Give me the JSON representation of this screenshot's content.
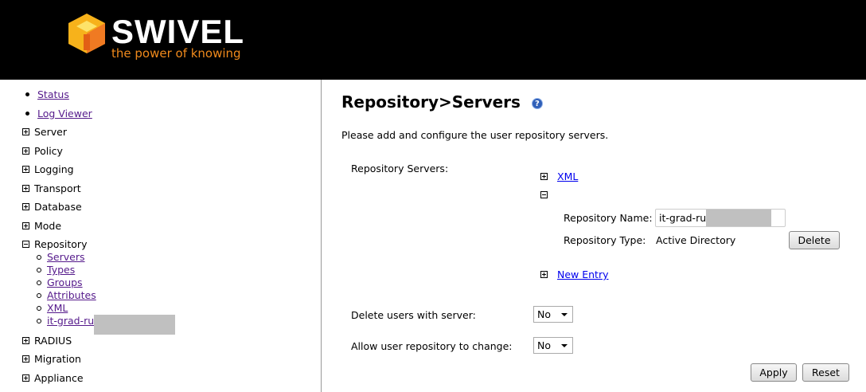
{
  "brand": {
    "name": "SWIVEL",
    "tagline": "the power of knowing",
    "accent": "#f08a1c"
  },
  "sidebar": {
    "links": [
      {
        "label": "Status"
      },
      {
        "label": "Log Viewer"
      }
    ],
    "sections": [
      {
        "label": "Server"
      },
      {
        "label": "Policy"
      },
      {
        "label": "Logging"
      },
      {
        "label": "Transport"
      },
      {
        "label": "Database"
      },
      {
        "label": "Mode"
      },
      {
        "label": "Repository"
      },
      {
        "label": "RADIUS"
      },
      {
        "label": "Migration"
      },
      {
        "label": "Appliance"
      }
    ],
    "repository_items": [
      {
        "label": "Servers"
      },
      {
        "label": "Types"
      },
      {
        "label": "Groups"
      },
      {
        "label": "Attributes"
      },
      {
        "label": "XML"
      },
      {
        "label": "it-grad-ru"
      }
    ]
  },
  "main": {
    "title": "Repository>Servers",
    "help_icon": "?",
    "description": "Please add and configure the user repository servers.",
    "repo_servers_label": "Repository Servers:",
    "xml_link": "XML",
    "repo_name_label": "Repository Name:",
    "repo_name_value": "it-grad-ru",
    "repo_type_label": "Repository Type:",
    "repo_type_value": "Active Directory",
    "delete_button": "Delete",
    "new_entry_link": "New Entry",
    "delete_users_label": "Delete users with server:",
    "delete_users_value": "No",
    "allow_change_label": "Allow user repository to change:",
    "allow_change_value": "No",
    "apply_button": "Apply",
    "reset_button": "Reset"
  }
}
